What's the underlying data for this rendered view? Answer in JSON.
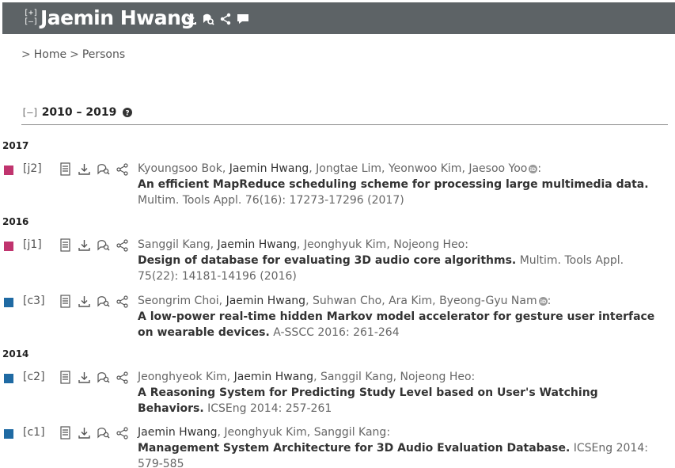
{
  "header": {
    "expand_label": "[+]",
    "collapse_label": "[–]",
    "name": "Jaemin Hwang",
    "icons": [
      "download-icon",
      "orcid-search-icon",
      "share-icon",
      "comment-icon"
    ]
  },
  "breadcrumb": {
    "sep": ">",
    "items": [
      "Home",
      "Persons"
    ]
  },
  "section": {
    "collapse_label": "[–]",
    "title": "2010 – 2019",
    "help_icon": "help-icon"
  },
  "colors": {
    "header_bg": "#5d6366",
    "journal_marker": "#c0346e",
    "conference_marker": "#1f6aa3"
  },
  "years": [
    "2017",
    "2016",
    "2014"
  ],
  "entries": [
    {
      "key": "[j2]",
      "type": "journal",
      "authors": [
        "Kyoungsoo Bok",
        "Jaemin Hwang",
        "Jongtae Lim",
        "Yeonwoo Kim",
        "Jaesoo Yoo"
      ],
      "title": "An efficient MapReduce scheduling scheme for processing large multimedia data.",
      "venue": "Multim. Tools Appl. 76(16): 17273-17296 (2017)"
    },
    {
      "key": "[j1]",
      "type": "journal",
      "authors": [
        "Sanggil Kang",
        "Jaemin Hwang",
        "Jeonghyuk Kim",
        "Nojeong Heo"
      ],
      "title": "Design of database for evaluating 3D audio core algorithms.",
      "venue": "Multim. Tools Appl. 75(22): 14181-14196 (2016)"
    },
    {
      "key": "[c3]",
      "type": "conference",
      "authors": [
        "Seongrim Choi",
        "Jaemin Hwang",
        "Suhwan Cho",
        "Ara Kim",
        "Byeong-Gyu Nam"
      ],
      "title": "A low-power real-time hidden Markov model accelerator for gesture user interface on wearable devices.",
      "venue": "A-SSCC 2016: 261-264"
    },
    {
      "key": "[c2]",
      "type": "conference",
      "authors": [
        "Jeonghyeok Kim",
        "Jaemin Hwang",
        "Sanggil Kang",
        "Nojeong Heo"
      ],
      "title": "A Reasoning System for Predicting Study Level based on User's Watching Behaviors.",
      "venue": "ICSEng 2014: 257-261"
    },
    {
      "key": "[c1]",
      "type": "conference",
      "authors": [
        "Jaemin Hwang",
        "Jeonghyuk Kim",
        "Sanggil Kang"
      ],
      "title": "Management System Architecture for 3D Audio Evaluation Database.",
      "venue": "ICSEng 2014: 579-585"
    }
  ]
}
